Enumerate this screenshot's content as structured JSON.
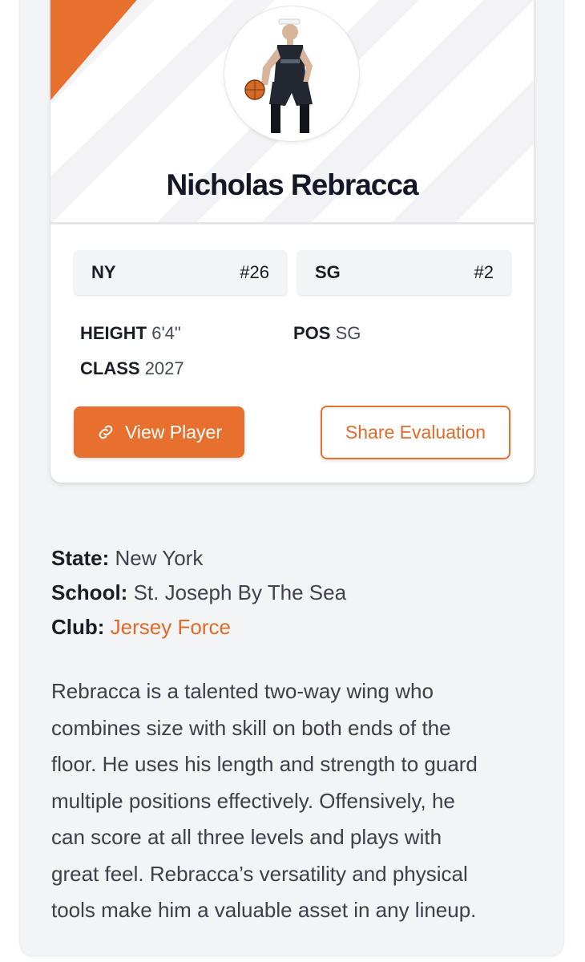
{
  "player": {
    "name": "Nicholas Rebracca",
    "state_code": "NY",
    "state_rank": "#26",
    "position_code": "SG",
    "position_rank": "#2",
    "height_label": "HEIGHT",
    "height_value": "6'4\"",
    "class_label": "CLASS",
    "class_value": "2027",
    "pos_label": "POS",
    "pos_value": "SG"
  },
  "actions": {
    "view_label": "View Player",
    "view_icon": "link-icon",
    "share_label": "Share Evaluation"
  },
  "details": {
    "state_label": "State:",
    "state_value": "New York",
    "school_label": "School:",
    "school_value": "St. Joseph By The Sea",
    "club_label": "Club:",
    "club_value": "Jersey Force"
  },
  "bio": {
    "lines": [
      "Rebracca is a talented two-way wing who",
      "combines size with skill on both ends of the",
      "floor. He uses his length and strength to guard",
      "multiple positions effectively. Offensively, he",
      "can score at all three levels and plays with",
      "great feel. Rebracca’s versatility and physical",
      "tools make him a valuable asset in any lineup."
    ]
  },
  "colors": {
    "accent": "#e8702e",
    "page_bg": "#f3f4f6",
    "card_bg": "#ffffff",
    "text": "#1a1d26"
  }
}
